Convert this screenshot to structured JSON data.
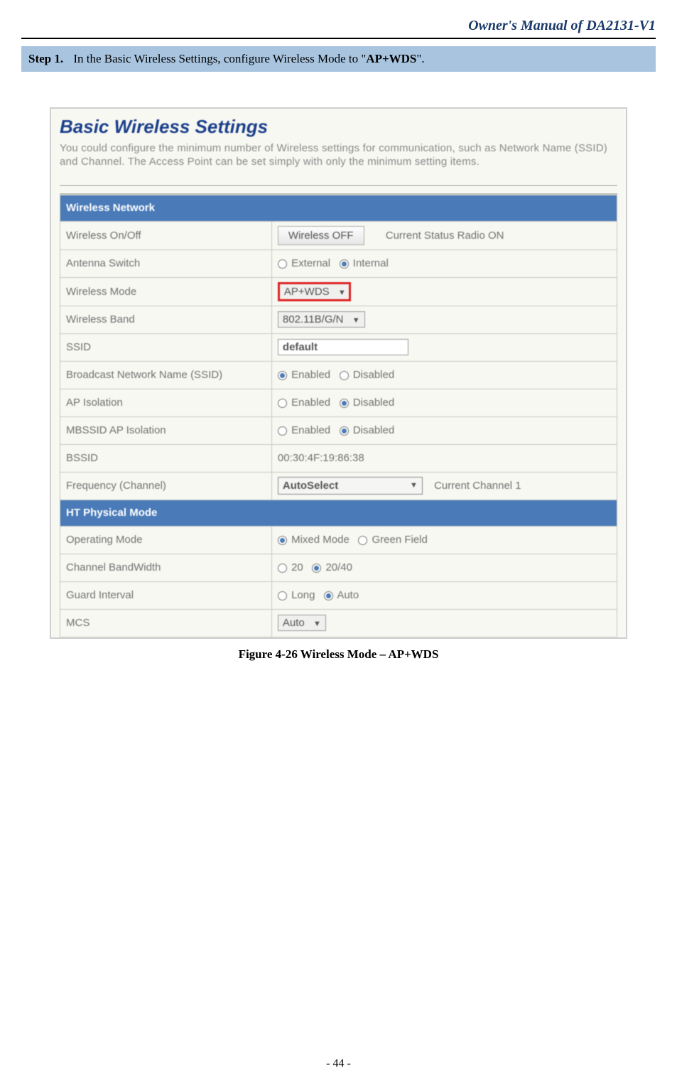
{
  "header": {
    "title": "Owner's Manual of DA2131-V1"
  },
  "step": {
    "label": "Step 1.",
    "text_before": "In the Basic Wireless Settings, configure Wireless Mode to \"",
    "bold": "AP+WDS",
    "text_after": "\"."
  },
  "screenshot": {
    "title": "Basic Wireless Settings",
    "description": "You could configure the minimum number of Wireless settings for communication, such as Network Name (SSID) and Channel. The Access Point can be set simply with only the minimum setting items.",
    "sections": {
      "wireless_network": {
        "header": "Wireless Network",
        "rows": {
          "onoff": {
            "label": "Wireless On/Off",
            "button": "Wireless OFF",
            "status": "Current Status Radio ON"
          },
          "antenna": {
            "label": "Antenna Switch",
            "opt1": "External",
            "opt2": "Internal"
          },
          "mode": {
            "label": "Wireless Mode",
            "value": "AP+WDS"
          },
          "band": {
            "label": "Wireless Band",
            "value": "802.11B/G/N"
          },
          "ssid": {
            "label": "SSID",
            "value": "default"
          },
          "broadcast": {
            "label": "Broadcast Network Name (SSID)",
            "opt1": "Enabled",
            "opt2": "Disabled"
          },
          "apiso": {
            "label": "AP Isolation",
            "opt1": "Enabled",
            "opt2": "Disabled"
          },
          "mbssid": {
            "label": "MBSSID AP Isolation",
            "opt1": "Enabled",
            "opt2": "Disabled"
          },
          "bssid": {
            "label": "BSSID",
            "value": "00:30:4F:19:86:38"
          },
          "freq": {
            "label": "Frequency (Channel)",
            "value": "AutoSelect",
            "status": "Current Channel  1"
          }
        }
      },
      "ht_physical": {
        "header": "HT Physical Mode",
        "rows": {
          "opmode": {
            "label": "Operating Mode",
            "opt1": "Mixed Mode",
            "opt2": "Green Field"
          },
          "chbw": {
            "label": "Channel BandWidth",
            "opt1": "20",
            "opt2": "20/40"
          },
          "guard": {
            "label": "Guard Interval",
            "opt1": "Long",
            "opt2": "Auto"
          },
          "mcs": {
            "label": "MCS",
            "value": "Auto"
          }
        }
      }
    }
  },
  "caption": "Figure 4-26 Wireless Mode – AP+WDS",
  "page_number": "- 44 -"
}
